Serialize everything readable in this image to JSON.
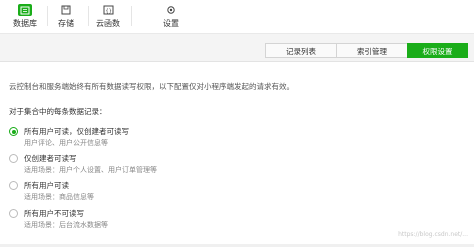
{
  "toolbar": {
    "items": [
      {
        "label": "数据库",
        "icon": "database-icon",
        "active": true
      },
      {
        "label": "存储",
        "icon": "storage-icon",
        "active": false
      },
      {
        "label": "云函数",
        "icon": "cloud-function-icon",
        "active": false
      },
      {
        "label": "设置",
        "icon": "gear-icon",
        "active": false
      }
    ]
  },
  "tabs": [
    {
      "label": "记录列表",
      "active": false
    },
    {
      "label": "索引管理",
      "active": false
    },
    {
      "label": "权限设置",
      "active": true
    }
  ],
  "content": {
    "description": "云控制台和服务端始终有所有数据读写权限，以下配置仅对小程序端发起的请求有效。",
    "section_title": "对于集合中的每条数据记录：",
    "options": [
      {
        "label": "所有用户可读，仅创建者可读写",
        "sub": "用户评论、用户公开信息等",
        "checked": true
      },
      {
        "label": "仅创建者可读写",
        "sub": "适用场景：用户个人设置、用户订单管理等",
        "checked": false
      },
      {
        "label": "所有用户可读",
        "sub": "适用场景：商品信息等",
        "checked": false
      },
      {
        "label": "所有用户不可读写",
        "sub": "适用场景：后台流水数据等",
        "checked": false
      }
    ]
  },
  "watermark": "https://blog.csdn.net/...",
  "colors": {
    "accent": "#1aad19",
    "tabbar_bg": "#f4f4f4"
  }
}
